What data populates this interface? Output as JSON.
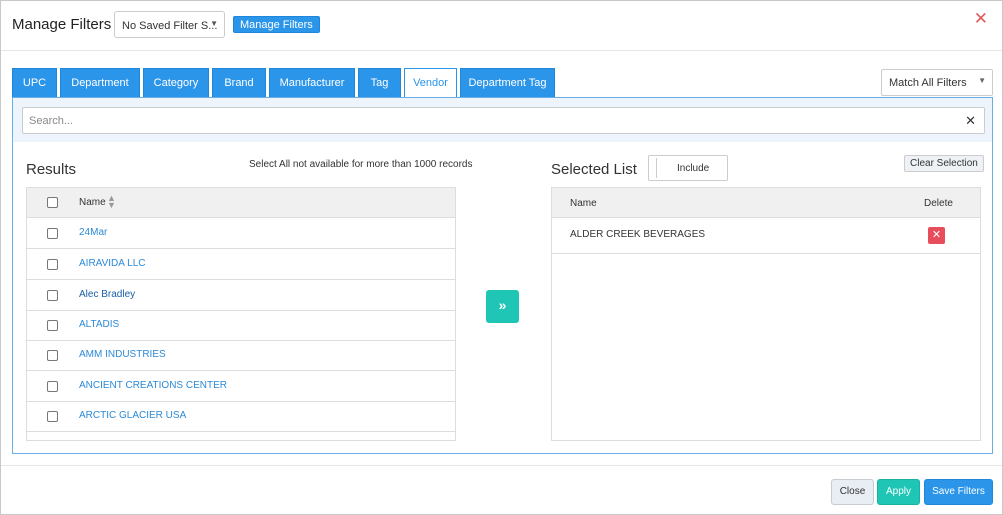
{
  "header": {
    "title": "Manage Filters",
    "saved_filter_value": "No Saved Filter S...",
    "manage_button": "Manage Filters",
    "close_glyph": "✕"
  },
  "tabs": [
    {
      "label": "UPC",
      "active": false
    },
    {
      "label": "Department",
      "active": false
    },
    {
      "label": "Category",
      "active": false
    },
    {
      "label": "Brand",
      "active": false
    },
    {
      "label": "Manufacturer",
      "active": false
    },
    {
      "label": "Tag",
      "active": false
    },
    {
      "label": "Vendor",
      "active": true
    },
    {
      "label": "Department Tag",
      "active": false
    }
  ],
  "match_select": {
    "value": "Match All Filters"
  },
  "search": {
    "placeholder": "Search...",
    "value": "",
    "clear_glyph": "✕"
  },
  "results": {
    "title": "Results",
    "note": "Select All not available for more than 1000 records",
    "column_name": "Name",
    "rows": [
      "24Mar",
      "AIRAVIDA LLC",
      "Alec Bradley",
      "ALTADIS",
      "AMM INDUSTRIES",
      "ANCIENT CREATIONS CENTER",
      "ARCTIC GLACIER USA"
    ]
  },
  "move_button": {
    "glyph": "»"
  },
  "selected": {
    "title": "Selected List",
    "include_label": "Include",
    "clear_selection": "Clear Selection",
    "column_name": "Name",
    "column_delete": "Delete",
    "rows": [
      "ALDER CREEK BEVERAGES"
    ],
    "delete_glyph": "✕"
  },
  "footer": {
    "close": "Close",
    "apply": "Apply",
    "save": "Save Filters"
  },
  "colors": {
    "primary": "#2b95ea",
    "teal": "#1fc6b6",
    "danger": "#e84d5b",
    "close_x": "#e05a5a"
  }
}
